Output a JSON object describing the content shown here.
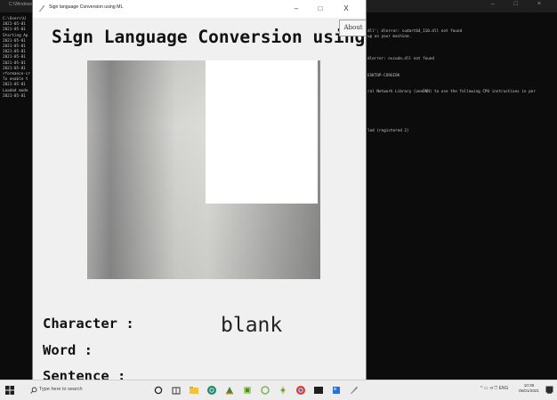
{
  "console": {
    "title": "C:\\Windows\\...",
    "controls": "–  □  ×",
    "left_lines": [
      "C:\\Users\\U",
      "2021-05-01",
      "2021-05-01",
      "Starting Ap",
      "2021-05-01",
      "2021-05-01",
      "2021-05-01",
      "2021-05-01",
      "2021-05-01",
      "2021-05-01",
      "rformance-cr",
      "To enable t",
      "2021-05-01",
      "Loaded mode",
      "2021-05-01"
    ],
    "right_lines": [
      {
        "text": "dll'; dlerror: cudart64_110.dll not found",
        "row": 0
      },
      {
        "text": "up on your machine.",
        "row": 1
      },
      {
        "text": "dlerror: nvcuda.dll not found",
        "row": 5
      },
      {
        "text": "ESKTOP-CO9GIOK",
        "row": 8
      },
      {
        "text": "ral Network Library (oneDNN) to use the following CPU instructions in per",
        "row": 11
      },
      {
        "text": "led (registered 2)",
        "row": 18
      }
    ]
  },
  "app": {
    "title": "Sign language Conversion using ML",
    "min_label": "–",
    "max_label": "□",
    "close_label": "X",
    "heading": "Sign Language Conversion using ML",
    "about_label": "About",
    "character_label": "Character :",
    "character_value": "blank",
    "word_label": "Word :",
    "sentence_label": "Sentence :"
  },
  "taskbar": {
    "search_placeholder": "Type here to search",
    "tray_text": "^ ▭ ⊲ ⛉ ENG",
    "time": "10:36",
    "date": "05/01/2021",
    "pinned_apps": [
      "task-view-icon",
      "store-icon",
      "file-explorer-icon",
      "chrome-icon",
      "photos-icon",
      "app-icon-5",
      "app-icon-6",
      "app-icon-7",
      "chrome-icon-2",
      "terminal-icon",
      "app-icon-10",
      "feather-app-icon"
    ]
  }
}
